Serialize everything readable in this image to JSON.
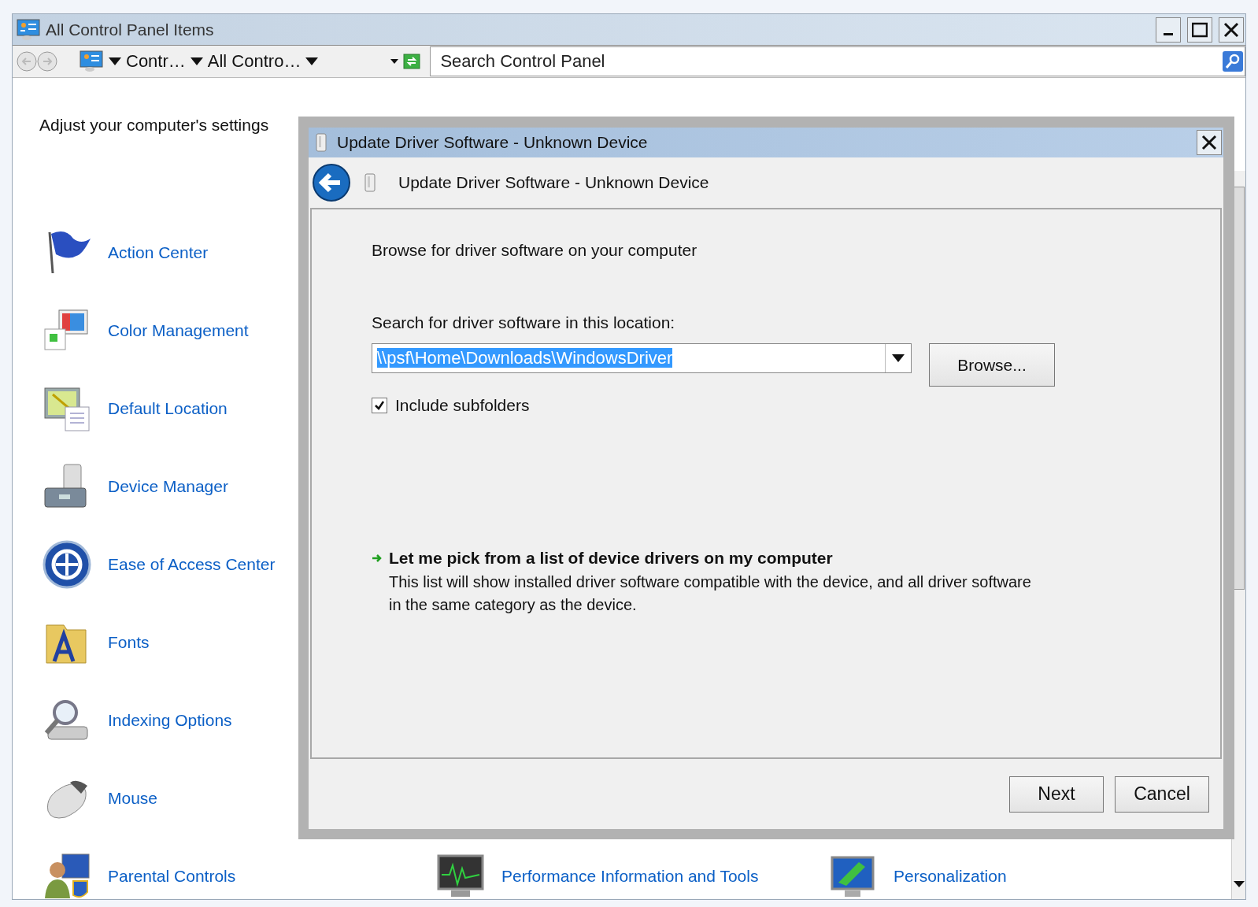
{
  "window": {
    "title": "All Control Panel Items"
  },
  "address_bar": {
    "segments": [
      "Contr…",
      "All Contro…"
    ]
  },
  "search": {
    "placeholder": "Search Control Panel"
  },
  "heading": "Adjust your computer's settings",
  "item_rows": [
    [
      {
        "label": "Action Center"
      }
    ],
    [
      {
        "label": "Color Management"
      }
    ],
    [
      {
        "label": "Default Location"
      }
    ],
    [
      {
        "label": "Device Manager"
      }
    ],
    [
      {
        "label": "Ease of Access Center"
      }
    ],
    [
      {
        "label": "Fonts"
      }
    ],
    [
      {
        "label": "Indexing Options"
      }
    ],
    [
      {
        "label": "Mouse"
      }
    ],
    [
      {
        "label": "Parental Controls"
      },
      {
        "label": "Performance Information and Tools"
      },
      {
        "label": "Personalization"
      }
    ]
  ],
  "dialog": {
    "title": "Update Driver Software - Unknown Device",
    "header": "Update Driver Software - Unknown Device",
    "heading": "Browse for driver software on your computer",
    "location_label": "Search for driver software in this location:",
    "location": {
      "value": "\\\\psf\\Home\\Downloads\\WindowsDriver",
      "selected": true
    },
    "browse_button": "Browse...",
    "include_subfolders": {
      "label": "Include subfolders",
      "checked": true
    },
    "pick_link": {
      "title": "Let me pick from a list of device drivers on my computer",
      "description": "This list will show installed driver software compatible with the device, and all driver software in the same category as the device."
    },
    "buttons": [
      "Next",
      "Cancel"
    ]
  }
}
